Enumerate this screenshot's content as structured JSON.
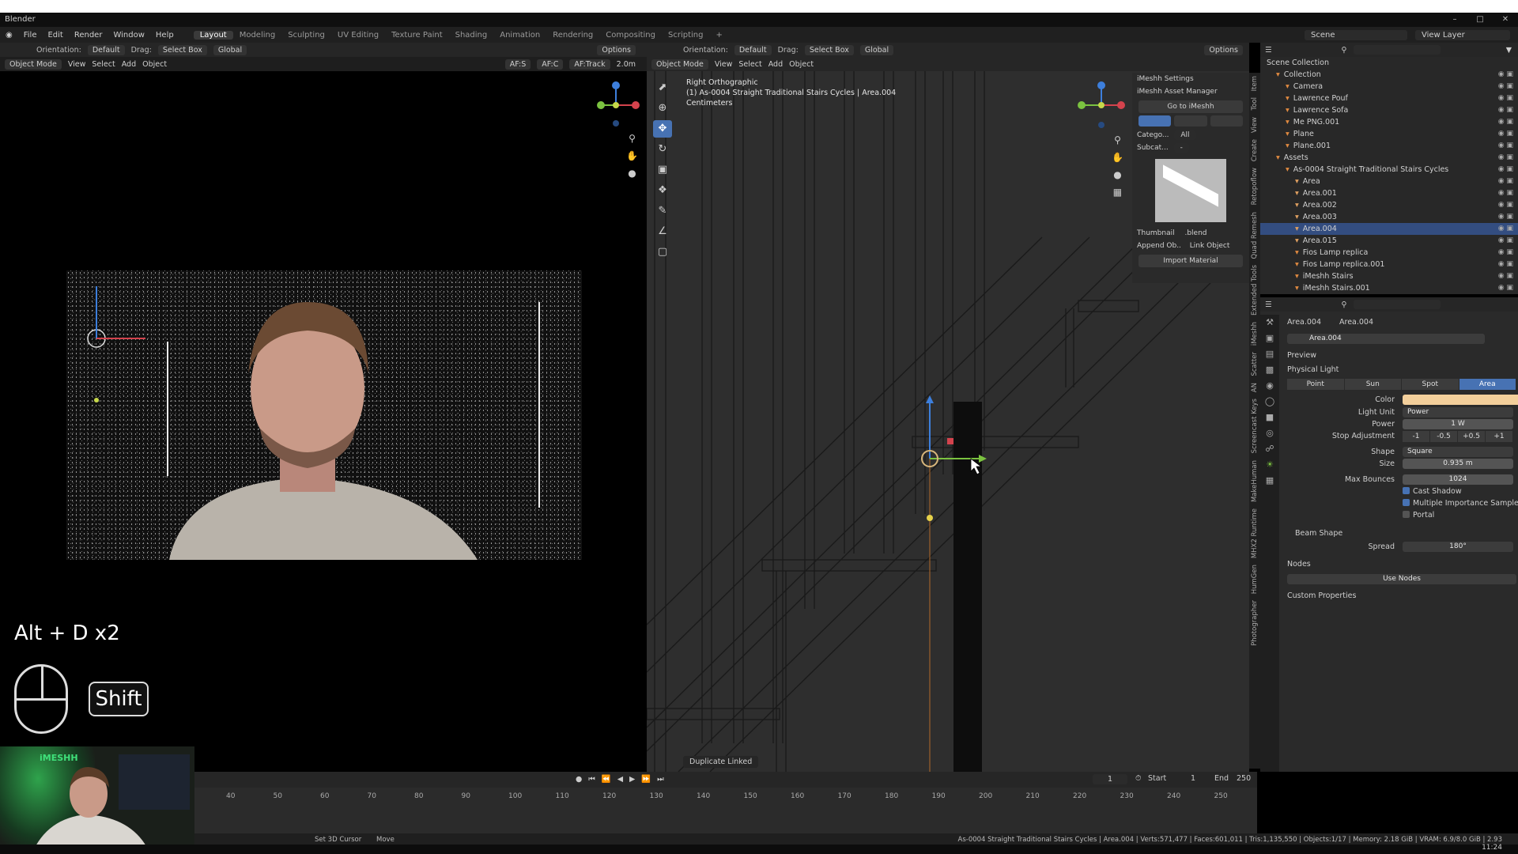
{
  "window": {
    "title": "Blender"
  },
  "menu": {
    "items": [
      "File",
      "Edit",
      "Render",
      "Window",
      "Help"
    ],
    "workspaces": [
      "Layout",
      "Modeling",
      "Sculpting",
      "UV Editing",
      "Texture Paint",
      "Shading",
      "Animation",
      "Rendering",
      "Compositing",
      "Scripting"
    ],
    "active_workspace": "Layout",
    "add_tab": "+",
    "scene": "Scene",
    "view_layer": "View Layer"
  },
  "left_editor": {
    "header": {
      "orientation_label": "Orientation:",
      "orientation_value": "Default",
      "drag_label": "Drag:",
      "drag_value": "Select Box",
      "transform": "Global",
      "options": "Options"
    },
    "subheader": {
      "mode": "Object Mode",
      "view": "View",
      "select": "Select",
      "add": "Add",
      "object": "Object",
      "af_s": "AF:S",
      "af_c": "AF:C",
      "af_track": "AF:Track",
      "distance": "2.0m"
    }
  },
  "overlay": {
    "shortcut": "Alt + D x2",
    "modifier_key": "Shift",
    "brand": "iMESHH"
  },
  "right_editor": {
    "header": {
      "orientation_label": "Orientation:",
      "orientation_value": "Default",
      "drag_label": "Drag:",
      "drag_value": "Select Box",
      "transform": "Global",
      "options": "Options"
    },
    "subheader": {
      "mode": "Object Mode",
      "view": "View",
      "select": "Select",
      "add": "Add",
      "object": "Object"
    },
    "view_name": "Right Orthographic",
    "context": "(1) As-0004 Straight Traditional Stairs Cycles | Area.004",
    "units": "Centimeters",
    "last_op": "Duplicate Linked"
  },
  "imeshh_panel": {
    "settings": "iMeshh Settings",
    "manager": "iMeshh Asset Manager",
    "goto": "Go to iMeshh",
    "category_label": "Catego...",
    "category_value": "All",
    "subcategory_label": "Subcat...",
    "subcategory_value": "-",
    "thumbnail": "Thumbnail",
    "blend": ".blend",
    "append": "Append Ob..",
    "link": "Link Object",
    "import_material": "Import Material"
  },
  "npanel_tabs": [
    "Item",
    "Tool",
    "View",
    "Create",
    "Retopoflow",
    "Quad Remesh",
    "Extended Tools",
    "iMeshh",
    "Scatter",
    "AN",
    "Screencast Keys",
    "MakeHuman",
    "MHX2 Runtime",
    "HumGen",
    "Photographer"
  ],
  "outliner": {
    "header": "Scene Collection",
    "rows": [
      {
        "indent": 1,
        "label": "Collection",
        "selected": false
      },
      {
        "indent": 2,
        "label": "Camera",
        "selected": false
      },
      {
        "indent": 2,
        "label": "Lawrence Pouf",
        "selected": false
      },
      {
        "indent": 2,
        "label": "Lawrence Sofa",
        "selected": false
      },
      {
        "indent": 2,
        "label": "Me PNG.001",
        "selected": false
      },
      {
        "indent": 2,
        "label": "Plane",
        "selected": false
      },
      {
        "indent": 2,
        "label": "Plane.001",
        "selected": false
      },
      {
        "indent": 1,
        "label": "Assets",
        "selected": false
      },
      {
        "indent": 2,
        "label": "As-0004 Straight Traditional Stairs Cycles",
        "selected": false
      },
      {
        "indent": 3,
        "label": "Area",
        "selected": false
      },
      {
        "indent": 3,
        "label": "Area.001",
        "selected": false
      },
      {
        "indent": 3,
        "label": "Area.002",
        "selected": false
      },
      {
        "indent": 3,
        "label": "Area.003",
        "selected": false
      },
      {
        "indent": 3,
        "label": "Area.004",
        "selected": true
      },
      {
        "indent": 3,
        "label": "Area.015",
        "selected": false
      },
      {
        "indent": 3,
        "label": "Fios Lamp replica",
        "selected": false
      },
      {
        "indent": 3,
        "label": "Fios Lamp replica.001",
        "selected": false
      },
      {
        "indent": 3,
        "label": "iMeshh Stairs",
        "selected": false
      },
      {
        "indent": 3,
        "label": "iMeshh Stairs.001",
        "selected": false
      }
    ]
  },
  "properties": {
    "object": "Area.004",
    "data": "Area.004",
    "datablock": "Area.004",
    "preview": "Preview",
    "physical_light": "Physical Light",
    "light_types": [
      "Point",
      "Sun",
      "Spot",
      "Area"
    ],
    "active_type": "Area",
    "color_label": "Color",
    "color": "#f3cf9b",
    "light_unit_label": "Light Unit",
    "light_unit": "Power",
    "power_label": "Power",
    "power": "1 W",
    "stop_label": "Stop Adjustment",
    "stops": [
      "-1",
      "-0.5",
      "+0.5",
      "+1"
    ],
    "shape_label": "Shape",
    "shape": "Square",
    "size_label": "Size",
    "size": "0.935 m",
    "bounces_label": "Max Bounces",
    "bounces": "1024",
    "cast_shadow": "Cast Shadow",
    "mis": "Multiple Importance Sample",
    "portal": "Portal",
    "beam_shape": "Beam Shape",
    "spread_label": "Spread",
    "spread": "180°",
    "nodes": "Nodes",
    "use_nodes": "Use Nodes",
    "custom_props": "Custom Properties"
  },
  "timeline": {
    "current_frame": "1",
    "start_label": "Start",
    "start": "1",
    "end_label": "End",
    "end": "250",
    "ticks": [
      "40",
      "50",
      "60",
      "70",
      "80",
      "90",
      "100",
      "110",
      "120",
      "130",
      "140",
      "150",
      "160",
      "170",
      "180",
      "190",
      "200",
      "210",
      "220",
      "230",
      "240",
      "250"
    ]
  },
  "status": {
    "left1": "Set 3D Cursor",
    "left2": "Move",
    "right": "As-0004 Straight Traditional Stairs Cycles | Area.004 | Verts:571,477 | Faces:601,011 | Tris:1,135,550 | Objects:1/17 | Memory: 2.18 GiB | VRAM: 6.9/8.0 GiB | 2.93",
    "clock": "11:24"
  },
  "colors": {
    "accent": "#4772b3",
    "light_color": "#f3cf9b"
  }
}
